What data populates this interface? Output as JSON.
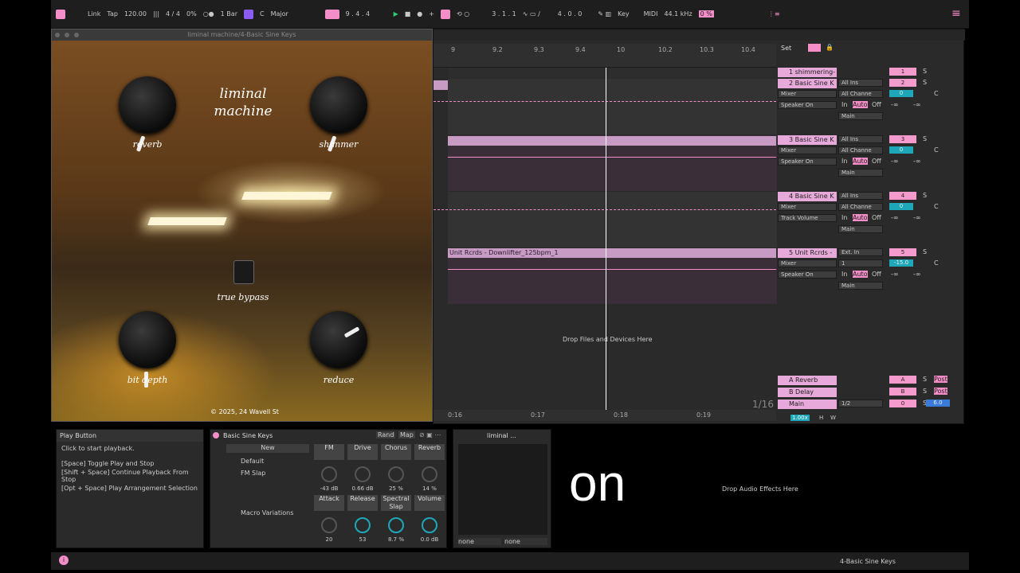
{
  "topbar": {
    "link": "Link",
    "tap": "Tap",
    "tempo": "120.00",
    "signature": "4 / 4",
    "swing": "0%",
    "quant": "1 Bar",
    "key": "C",
    "scale": "Major",
    "position": "9 . 4 . 4",
    "loop_start": "3 . 1 . 1",
    "loop_len": "4 . 0 . 0",
    "key_label": "Key",
    "midi": "MIDI",
    "sample_rate": "44.1 kHz",
    "cpu": "0 %"
  },
  "plugin": {
    "window_title": "liminal machine/4-Basic Sine Keys",
    "title": "liminal machine",
    "knob_reverb": "reverb",
    "knob_shimmer": "shimmer",
    "knob_bitdepth": "bit depth",
    "knob_reduce": "reduce",
    "bypass": "true bypass",
    "copyright": "© 2025, 24 Wavell St"
  },
  "arrangement": {
    "ticks": [
      "9",
      "9.2",
      "9.3",
      "9.4",
      "10",
      "10.2",
      "10.3",
      "10.4"
    ],
    "time_ticks": [
      "0:16",
      "0:17",
      "0:18",
      "0:19"
    ],
    "set_label": "Set",
    "clip5": "Unit Rcrds - Downlifter_125bpm_1",
    "drop_hint": "Drop Files and Devices Here",
    "grid": "1/16",
    "zoom": "1.00x",
    "h": "H",
    "w": "W",
    "tracks": [
      {
        "name": "1 shimmering-",
        "num": "1"
      },
      {
        "name": "2 Basic Sine K",
        "num": "2",
        "in": "All Ins",
        "ch": "All Channe",
        "dev": "Mixer",
        "out": "Speaker On",
        "route": "Main",
        "vol": "0"
      },
      {
        "name": "3 Basic Sine K",
        "num": "3",
        "in": "All Ins",
        "ch": "All Channe",
        "dev": "Mixer",
        "out": "Speaker On",
        "route": "Main",
        "vol": "0"
      },
      {
        "name": "4 Basic Sine K",
        "num": "4",
        "in": "All Ins",
        "ch": "All Channe",
        "dev": "Mixer",
        "out": "Track Volume",
        "route": "Main",
        "vol": "0"
      },
      {
        "name": "5 Unit Rcrds -",
        "num": "5",
        "in": "Ext. In",
        "ch": "1",
        "dev": "Mixer",
        "out": "Speaker On",
        "route": "Main",
        "vol": "-15.0"
      }
    ],
    "returns": [
      {
        "name": "A Reverb",
        "num": "A",
        "post": "Post"
      },
      {
        "name": "B Delay",
        "num": "B",
        "post": "Post"
      },
      {
        "name": "Main",
        "num": "0",
        "vol": "6.0",
        "cue": "1/2"
      }
    ],
    "s_label": "S",
    "c_label": "C",
    "in_label": "In",
    "auto_label": "Auto",
    "off_label": "Off",
    "neg_inf": "-∞"
  },
  "info": {
    "title": "Play Button",
    "line1": "Click to start playback.",
    "line2": "[Space] Toggle Play and Stop",
    "line3": "[Shift + Space] Continue Playback From Stop",
    "line4": "[Opt + Space] Play Arrangement Selection"
  },
  "rack": {
    "title": "Basic Sine Keys",
    "rand": "Rand",
    "map": "Map",
    "new": "New",
    "presets": [
      "Default",
      "FM Slap"
    ],
    "variations": "Macro Variations",
    "macros": [
      {
        "name": "FM",
        "value": "-43 dB"
      },
      {
        "name": "Drive",
        "value": "0.66 dB"
      },
      {
        "name": "Chorus",
        "value": "25 %"
      },
      {
        "name": "Reverb",
        "value": "14 %"
      },
      {
        "name": "Attack",
        "value": "20"
      },
      {
        "name": "Release",
        "value": "53"
      },
      {
        "name": "Spectral Slap",
        "value": "8.7 %"
      },
      {
        "name": "Volume",
        "value": "0.0 dB"
      }
    ]
  },
  "device2": {
    "title": "liminal ...",
    "sel1": "none",
    "sel2": "none"
  },
  "overlay_text": "on",
  "drop_audio": "Drop Audio Effects Here",
  "statusbar": {
    "track": "4-Basic Sine Keys"
  }
}
